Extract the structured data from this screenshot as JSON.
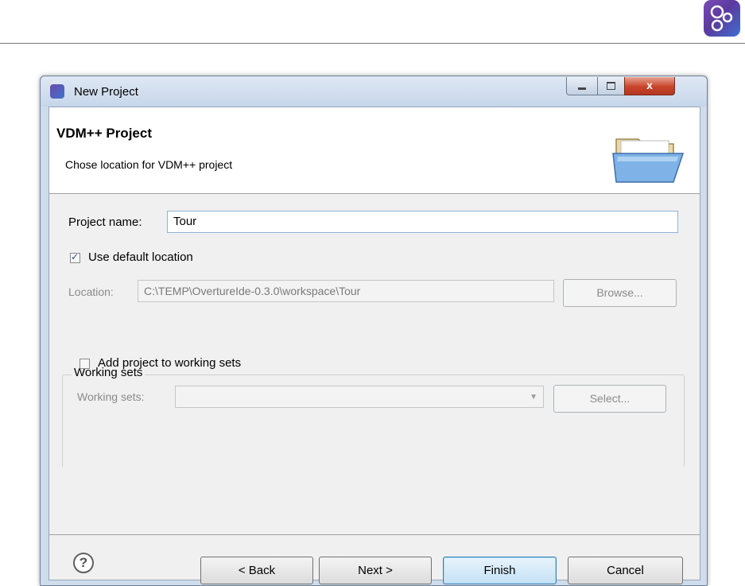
{
  "dialog": {
    "title": "New Project",
    "header": {
      "title": "VDM++ Project",
      "description": "Chose location for VDM++ project"
    },
    "project_name": {
      "label": "Project name:",
      "value": "Tour"
    },
    "use_default_location": {
      "label": "Use default location",
      "checked": true
    },
    "location": {
      "label": "Location:",
      "value": "C:\\TEMP\\OvertureIde-0.3.0\\workspace\\Tour",
      "browse_label": "Browse..."
    },
    "working_sets": {
      "group_title": "Working sets",
      "add_label": "Add project to working sets",
      "add_checked": false,
      "field_label": "Working sets:",
      "value": "",
      "select_label": "Select..."
    },
    "buttons": {
      "help": "?",
      "back": "< Back",
      "next": "Next >",
      "finish": "Finish",
      "cancel": "Cancel"
    },
    "window_controls": {
      "close": "x"
    }
  },
  "colors": {
    "titlebar": "#c6d6ea",
    "close_button": "#c8442a",
    "logo": "#6a47ad",
    "default_button": "#3c7fb1"
  }
}
